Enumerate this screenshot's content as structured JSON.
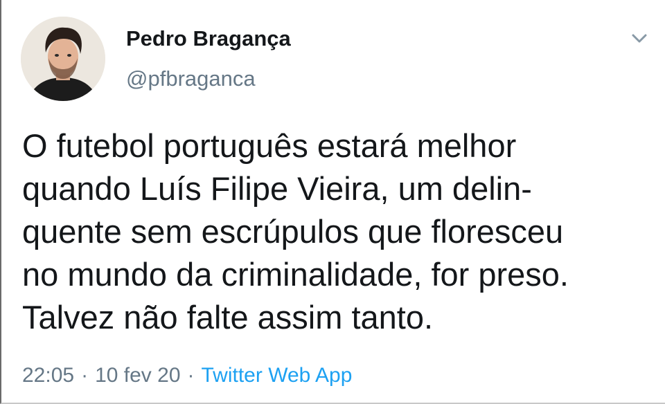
{
  "tweet": {
    "author": {
      "display_name": "Pedro Bragança",
      "handle": "@pfbraganca"
    },
    "menu_icon": "chevron-down-icon",
    "text_lines": [
      "O futebol português estará melhor",
      "quando Luís Filipe Vieira, um delin-",
      "quente sem escrúpulos que floresceu",
      "no mundo da criminalidade, for preso.",
      "Talvez não falte assim tanto."
    ],
    "time": "22:05",
    "date": "10 fev 20",
    "separator": "·",
    "source": "Twitter Web App"
  },
  "colors": {
    "text": "#14171a",
    "secondary": "#657786",
    "link": "#1da1f2",
    "background": "#ffffff"
  }
}
